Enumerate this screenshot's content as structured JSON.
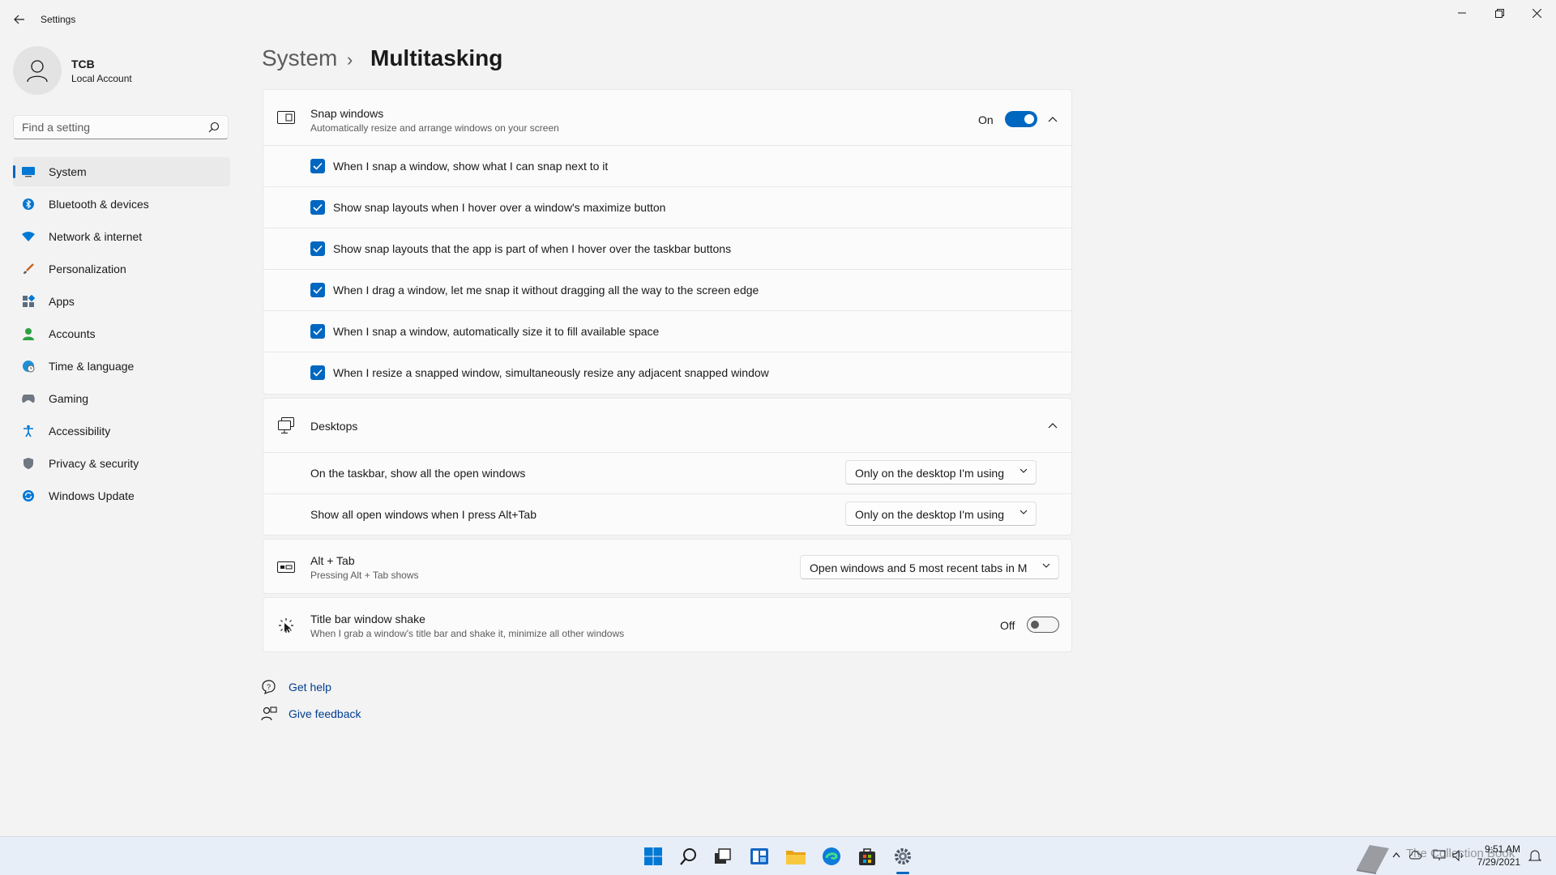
{
  "window": {
    "title": "Settings",
    "back_icon": "back-arrow-icon",
    "controls": [
      "minimize",
      "restore",
      "close"
    ]
  },
  "profile": {
    "name": "TCB",
    "account_type": "Local Account"
  },
  "search": {
    "placeholder": "Find a setting"
  },
  "nav": {
    "items": [
      {
        "label": "System",
        "icon": "monitor-icon",
        "active": true
      },
      {
        "label": "Bluetooth & devices",
        "icon": "bluetooth-icon"
      },
      {
        "label": "Network & internet",
        "icon": "wifi-icon"
      },
      {
        "label": "Personalization",
        "icon": "brush-icon"
      },
      {
        "label": "Apps",
        "icon": "apps-icon"
      },
      {
        "label": "Accounts",
        "icon": "person-icon"
      },
      {
        "label": "Time & language",
        "icon": "globe-clock-icon"
      },
      {
        "label": "Gaming",
        "icon": "controller-icon"
      },
      {
        "label": "Accessibility",
        "icon": "accessibility-icon"
      },
      {
        "label": "Privacy & security",
        "icon": "shield-icon"
      },
      {
        "label": "Windows Update",
        "icon": "update-icon"
      }
    ]
  },
  "breadcrumb": {
    "parent": "System",
    "separator": "›",
    "current": "Multitasking"
  },
  "snap": {
    "title": "Snap windows",
    "subtitle": "Automatically resize and arrange windows on your screen",
    "state_label": "On",
    "enabled": true,
    "options": [
      {
        "label": "When I snap a window, show what I can snap next to it",
        "checked": true
      },
      {
        "label": "Show snap layouts when I hover over a window's maximize button",
        "checked": true
      },
      {
        "label": "Show snap layouts that the app is part of when I hover over the taskbar buttons",
        "checked": true
      },
      {
        "label": "When I drag a window, let me snap it without dragging all the way to the screen edge",
        "checked": true
      },
      {
        "label": "When I snap a window, automatically size it to fill available space",
        "checked": true
      },
      {
        "label": "When I resize a snapped window, simultaneously resize any adjacent snapped window",
        "checked": true
      }
    ]
  },
  "desktops": {
    "title": "Desktops",
    "rows": [
      {
        "label": "On the taskbar, show all the open windows",
        "value": "Only on the desktop I'm using"
      },
      {
        "label": "Show all open windows when I press Alt+Tab",
        "value": "Only on the desktop I'm using"
      }
    ]
  },
  "alttab": {
    "title": "Alt + Tab",
    "subtitle": "Pressing Alt + Tab shows",
    "value": "Open windows and 5 most recent tabs in M"
  },
  "shake": {
    "title": "Title bar window shake",
    "subtitle": "When I grab a window's title bar and shake it, minimize all other windows",
    "state_label": "Off",
    "enabled": false
  },
  "help": {
    "get_help": "Get help",
    "give_feedback": "Give feedback"
  },
  "taskbar": {
    "apps": [
      "start-icon",
      "search-icon",
      "task-view-icon",
      "widgets-icon",
      "file-explorer-icon",
      "edge-icon",
      "store-icon",
      "settings-icon"
    ],
    "time": "9:51 AM",
    "date": "7/29/2021",
    "watermark": "The Collection Book"
  },
  "colors": {
    "accent": "#0067c0",
    "background": "#f3f3f3",
    "card": "#fbfbfb"
  }
}
